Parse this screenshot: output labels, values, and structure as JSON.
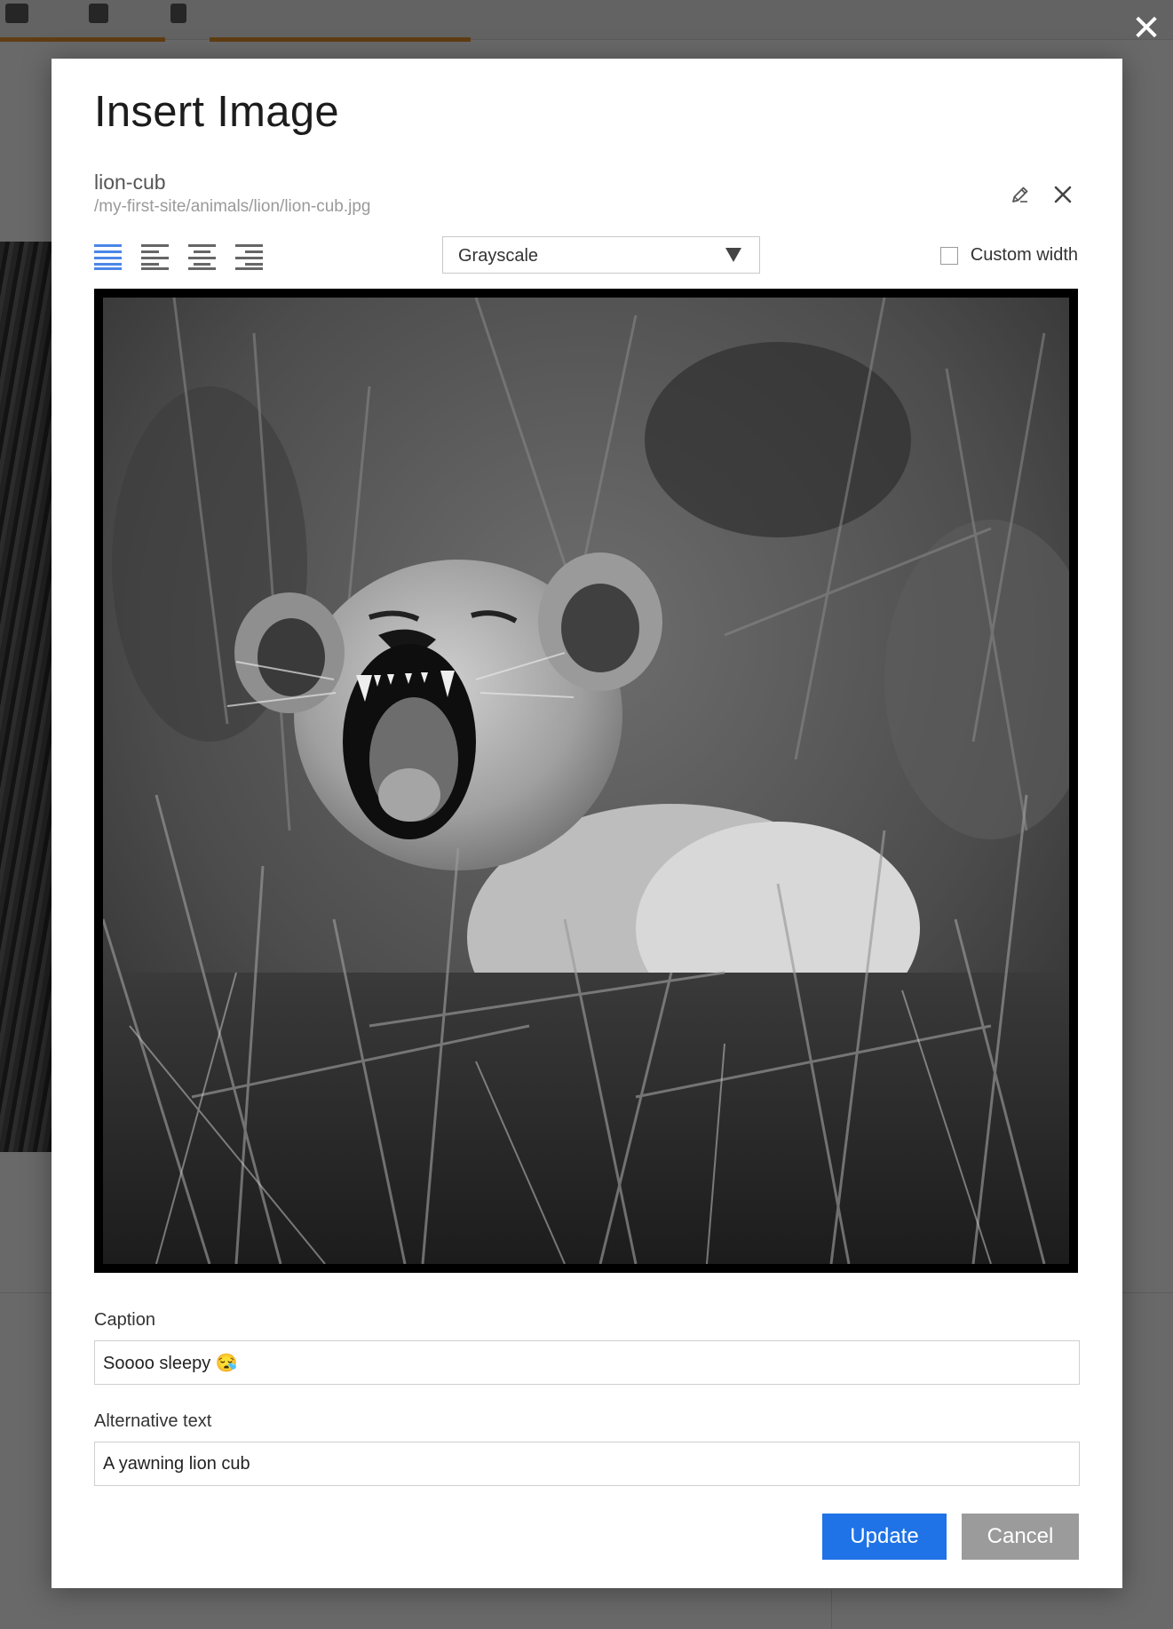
{
  "dialog": {
    "title": "Insert Image",
    "close_glyph": "✕"
  },
  "file": {
    "name": "lion-cub",
    "path": "/my-first-site/animals/lion/lion-cub.jpg",
    "actions": [
      "edit-icon",
      "remove-icon"
    ]
  },
  "toolbar": {
    "alignments": [
      {
        "name": "full-width",
        "selected": true
      },
      {
        "name": "left",
        "selected": false
      },
      {
        "name": "center",
        "selected": false
      },
      {
        "name": "right",
        "selected": false
      }
    ],
    "filter": {
      "selected": "Grayscale"
    },
    "custom_width": {
      "label": "Custom width",
      "checked": false
    }
  },
  "form": {
    "caption_label": "Caption",
    "caption_value": "Soooo sleepy 😪",
    "alt_label": "Alternative text",
    "alt_value": "A yawning lion cub"
  },
  "buttons": {
    "update": "Update",
    "cancel": "Cancel"
  },
  "colors": {
    "accent": "#1f73e6",
    "cancel": "#9b9b9b",
    "selected_icon": "#4a86e8"
  }
}
